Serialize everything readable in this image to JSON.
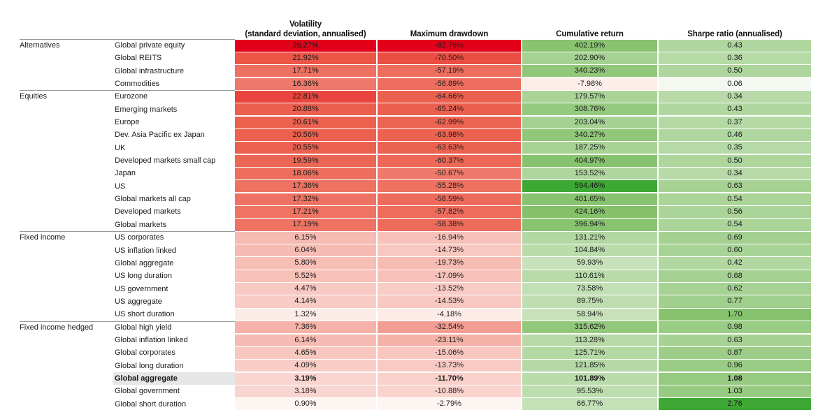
{
  "table": {
    "columns": [
      {
        "id": "volatility",
        "line1": "Volatility",
        "line2": "(standard deviation, annualised)"
      },
      {
        "id": "max_drawdown",
        "line1": "Maximum drawdown",
        "line2": ""
      },
      {
        "id": "cumulative_return",
        "line1": "Cumulative return",
        "line2": ""
      },
      {
        "id": "sharpe_ratio",
        "line1": "Sharpe ratio (annualised)",
        "line2": ""
      }
    ],
    "groups": [
      {
        "name": "Alternatives",
        "rows": [
          {
            "asset": "Global private equity",
            "volatility": "26.27%",
            "max_drawdown": "-82.76%",
            "cumulative_return": "402.19%",
            "sharpe_ratio": "0.43",
            "highlight": false
          },
          {
            "asset": "Global REITS",
            "volatility": "21.92%",
            "max_drawdown": "-70.50%",
            "cumulative_return": "202.90%",
            "sharpe_ratio": "0.36",
            "highlight": false
          },
          {
            "asset": "Global infrastructure",
            "volatility": "17.71%",
            "max_drawdown": "-57.19%",
            "cumulative_return": "340.23%",
            "sharpe_ratio": "0.50",
            "highlight": false
          },
          {
            "asset": "Commodities",
            "volatility": "16.36%",
            "max_drawdown": "-56.89%",
            "cumulative_return": "-7.98%",
            "sharpe_ratio": "0.06",
            "highlight": false
          }
        ]
      },
      {
        "name": "Equities",
        "rows": [
          {
            "asset": "Eurozone",
            "volatility": "22.81%",
            "max_drawdown": "-64.66%",
            "cumulative_return": "179.57%",
            "sharpe_ratio": "0.34",
            "highlight": false
          },
          {
            "asset": "Emerging markets",
            "volatility": "20.88%",
            "max_drawdown": "-65.24%",
            "cumulative_return": "308.76%",
            "sharpe_ratio": "0.43",
            "highlight": false
          },
          {
            "asset": "Europe",
            "volatility": "20.61%",
            "max_drawdown": "-62.99%",
            "cumulative_return": "203.04%",
            "sharpe_ratio": "0.37",
            "highlight": false
          },
          {
            "asset": "Dev. Asia Pacific ex Japan",
            "volatility": "20.56%",
            "max_drawdown": "-63.98%",
            "cumulative_return": "340.27%",
            "sharpe_ratio": "0.46",
            "highlight": false
          },
          {
            "asset": "UK",
            "volatility": "20.55%",
            "max_drawdown": "-63.63%",
            "cumulative_return": "187.25%",
            "sharpe_ratio": "0.35",
            "highlight": false
          },
          {
            "asset": "Developed markets small cap",
            "volatility": "19.59%",
            "max_drawdown": "-60.37%",
            "cumulative_return": "404.97%",
            "sharpe_ratio": "0.50",
            "highlight": false
          },
          {
            "asset": "Japan",
            "volatility": "18.06%",
            "max_drawdown": "-50.67%",
            "cumulative_return": "153.52%",
            "sharpe_ratio": "0.34",
            "highlight": false
          },
          {
            "asset": "US",
            "volatility": "17.36%",
            "max_drawdown": "-55.28%",
            "cumulative_return": "594.46%",
            "sharpe_ratio": "0.63",
            "highlight": false
          },
          {
            "asset": "Global markets all cap",
            "volatility": "17.32%",
            "max_drawdown": "-58.59%",
            "cumulative_return": "401.65%",
            "sharpe_ratio": "0.54",
            "highlight": false
          },
          {
            "asset": "Developed markets",
            "volatility": "17.21%",
            "max_drawdown": "-57.82%",
            "cumulative_return": "424.16%",
            "sharpe_ratio": "0.56",
            "highlight": false
          },
          {
            "asset": "Global markets",
            "volatility": "17.19%",
            "max_drawdown": "-58.38%",
            "cumulative_return": "396.94%",
            "sharpe_ratio": "0.54",
            "highlight": false
          }
        ]
      },
      {
        "name": "Fixed income",
        "rows": [
          {
            "asset": "US corporates",
            "volatility": "6.15%",
            "max_drawdown": "-16.94%",
            "cumulative_return": "131.21%",
            "sharpe_ratio": "0.69",
            "highlight": false
          },
          {
            "asset": "US inflation linked",
            "volatility": "6.04%",
            "max_drawdown": "-14.73%",
            "cumulative_return": "104.84%",
            "sharpe_ratio": "0.60",
            "highlight": false
          },
          {
            "asset": "Global aggregate",
            "volatility": "5.80%",
            "max_drawdown": "-19.73%",
            "cumulative_return": "59.93%",
            "sharpe_ratio": "0.42",
            "highlight": false
          },
          {
            "asset": "US long duration",
            "volatility": "5.52%",
            "max_drawdown": "-17.09%",
            "cumulative_return": "110.61%",
            "sharpe_ratio": "0.68",
            "highlight": false
          },
          {
            "asset": "US government",
            "volatility": "4.47%",
            "max_drawdown": "-13.52%",
            "cumulative_return": "73.58%",
            "sharpe_ratio": "0.62",
            "highlight": false
          },
          {
            "asset": "US aggregate",
            "volatility": "4.14%",
            "max_drawdown": "-14.53%",
            "cumulative_return": "89.75%",
            "sharpe_ratio": "0.77",
            "highlight": false
          },
          {
            "asset": "US short duration",
            "volatility": "1.32%",
            "max_drawdown": "-4.18%",
            "cumulative_return": "58.94%",
            "sharpe_ratio": "1.70",
            "highlight": false
          }
        ]
      },
      {
        "name": "Fixed income hedged",
        "rows": [
          {
            "asset": "Global high yield",
            "volatility": "7.36%",
            "max_drawdown": "-32.54%",
            "cumulative_return": "315.62%",
            "sharpe_ratio": "0.98",
            "highlight": false
          },
          {
            "asset": "Global inflation linked",
            "volatility": "6.14%",
            "max_drawdown": "-23.11%",
            "cumulative_return": "113.28%",
            "sharpe_ratio": "0.63",
            "highlight": false
          },
          {
            "asset": "Global corporates",
            "volatility": "4.65%",
            "max_drawdown": "-15.06%",
            "cumulative_return": "125.71%",
            "sharpe_ratio": "0.87",
            "highlight": false
          },
          {
            "asset": "Global long duration",
            "volatility": "4.09%",
            "max_drawdown": "-13.73%",
            "cumulative_return": "121.85%",
            "sharpe_ratio": "0.96",
            "highlight": false
          },
          {
            "asset": "Global aggregate",
            "volatility": "3.19%",
            "max_drawdown": "-11.70%",
            "cumulative_return": "101.89%",
            "sharpe_ratio": "1.08",
            "highlight": true
          },
          {
            "asset": "Global government",
            "volatility": "3.18%",
            "max_drawdown": "-10.88%",
            "cumulative_return": "95.53%",
            "sharpe_ratio": "1.03",
            "highlight": false
          },
          {
            "asset": "Global short duration",
            "volatility": "0.90%",
            "max_drawdown": "-2.79%",
            "cumulative_return": "66.77%",
            "sharpe_ratio": "2.76",
            "highlight": false
          }
        ]
      }
    ]
  },
  "heatmap": {
    "red_strong": "#E2001A",
    "red_mid": "#E8503F",
    "red_light": "#FBE9E3",
    "red_faint": "#FDF6F3",
    "green_strong": "#3FAA35",
    "green_mid": "#7EBE63",
    "green_light": "#E5EFE0",
    "green_faint": "#F2F7EF",
    "highlight_bg": "#E6E6E6",
    "separator": "#9A9A9A"
  },
  "chart_data": {
    "type": "heatmap",
    "title": "",
    "xlabel": "",
    "ylabel": "",
    "grid": false,
    "legend": "none",
    "columns": [
      "Volatility (standard deviation, annualised)",
      "Maximum drawdown",
      "Cumulative return",
      "Sharpe ratio (annualised)"
    ],
    "row_groups": [
      "Alternatives",
      "Equities",
      "Fixed income",
      "Fixed income hedged"
    ],
    "rows": [
      {
        "group": "Alternatives",
        "asset": "Global private equity",
        "volatility": 26.27,
        "max_drawdown": -82.76,
        "cumulative_return": 402.19,
        "sharpe_ratio": 0.43
      },
      {
        "group": "Alternatives",
        "asset": "Global REITS",
        "volatility": 21.92,
        "max_drawdown": -70.5,
        "cumulative_return": 202.9,
        "sharpe_ratio": 0.36
      },
      {
        "group": "Alternatives",
        "asset": "Global infrastructure",
        "volatility": 17.71,
        "max_drawdown": -57.19,
        "cumulative_return": 340.23,
        "sharpe_ratio": 0.5
      },
      {
        "group": "Alternatives",
        "asset": "Commodities",
        "volatility": 16.36,
        "max_drawdown": -56.89,
        "cumulative_return": -7.98,
        "sharpe_ratio": 0.06
      },
      {
        "group": "Equities",
        "asset": "Eurozone",
        "volatility": 22.81,
        "max_drawdown": -64.66,
        "cumulative_return": 179.57,
        "sharpe_ratio": 0.34
      },
      {
        "group": "Equities",
        "asset": "Emerging markets",
        "volatility": 20.88,
        "max_drawdown": -65.24,
        "cumulative_return": 308.76,
        "sharpe_ratio": 0.43
      },
      {
        "group": "Equities",
        "asset": "Europe",
        "volatility": 20.61,
        "max_drawdown": -62.99,
        "cumulative_return": 203.04,
        "sharpe_ratio": 0.37
      },
      {
        "group": "Equities",
        "asset": "Dev. Asia Pacific ex Japan",
        "volatility": 20.56,
        "max_drawdown": -63.98,
        "cumulative_return": 340.27,
        "sharpe_ratio": 0.46
      },
      {
        "group": "Equities",
        "asset": "UK",
        "volatility": 20.55,
        "max_drawdown": -63.63,
        "cumulative_return": 187.25,
        "sharpe_ratio": 0.35
      },
      {
        "group": "Equities",
        "asset": "Developed markets small cap",
        "volatility": 19.59,
        "max_drawdown": -60.37,
        "cumulative_return": 404.97,
        "sharpe_ratio": 0.5
      },
      {
        "group": "Equities",
        "asset": "Japan",
        "volatility": 18.06,
        "max_drawdown": -50.67,
        "cumulative_return": 153.52,
        "sharpe_ratio": 0.34
      },
      {
        "group": "Equities",
        "asset": "US",
        "volatility": 17.36,
        "max_drawdown": -55.28,
        "cumulative_return": 594.46,
        "sharpe_ratio": 0.63
      },
      {
        "group": "Equities",
        "asset": "Global markets all cap",
        "volatility": 17.32,
        "max_drawdown": -58.59,
        "cumulative_return": 401.65,
        "sharpe_ratio": 0.54
      },
      {
        "group": "Equities",
        "asset": "Developed markets",
        "volatility": 17.21,
        "max_drawdown": -57.82,
        "cumulative_return": 424.16,
        "sharpe_ratio": 0.56
      },
      {
        "group": "Equities",
        "asset": "Global markets",
        "volatility": 17.19,
        "max_drawdown": -58.38,
        "cumulative_return": 396.94,
        "sharpe_ratio": 0.54
      },
      {
        "group": "Fixed income",
        "asset": "US corporates",
        "volatility": 6.15,
        "max_drawdown": -16.94,
        "cumulative_return": 131.21,
        "sharpe_ratio": 0.69
      },
      {
        "group": "Fixed income",
        "asset": "US inflation linked",
        "volatility": 6.04,
        "max_drawdown": -14.73,
        "cumulative_return": 104.84,
        "sharpe_ratio": 0.6
      },
      {
        "group": "Fixed income",
        "asset": "Global aggregate",
        "volatility": 5.8,
        "max_drawdown": -19.73,
        "cumulative_return": 59.93,
        "sharpe_ratio": 0.42
      },
      {
        "group": "Fixed income",
        "asset": "US long duration",
        "volatility": 5.52,
        "max_drawdown": -17.09,
        "cumulative_return": 110.61,
        "sharpe_ratio": 0.68
      },
      {
        "group": "Fixed income",
        "asset": "US government",
        "volatility": 4.47,
        "max_drawdown": -13.52,
        "cumulative_return": 73.58,
        "sharpe_ratio": 0.62
      },
      {
        "group": "Fixed income",
        "asset": "US aggregate",
        "volatility": 4.14,
        "max_drawdown": -14.53,
        "cumulative_return": 89.75,
        "sharpe_ratio": 0.77
      },
      {
        "group": "Fixed income",
        "asset": "US short duration",
        "volatility": 1.32,
        "max_drawdown": -4.18,
        "cumulative_return": 58.94,
        "sharpe_ratio": 1.7
      },
      {
        "group": "Fixed income hedged",
        "asset": "Global high yield",
        "volatility": 7.36,
        "max_drawdown": -32.54,
        "cumulative_return": 315.62,
        "sharpe_ratio": 0.98
      },
      {
        "group": "Fixed income hedged",
        "asset": "Global inflation linked",
        "volatility": 6.14,
        "max_drawdown": -23.11,
        "cumulative_return": 113.28,
        "sharpe_ratio": 0.63
      },
      {
        "group": "Fixed income hedged",
        "asset": "Global corporates",
        "volatility": 4.65,
        "max_drawdown": -15.06,
        "cumulative_return": 125.71,
        "sharpe_ratio": 0.87
      },
      {
        "group": "Fixed income hedged",
        "asset": "Global long duration",
        "volatility": 4.09,
        "max_drawdown": -13.73,
        "cumulative_return": 121.85,
        "sharpe_ratio": 0.96
      },
      {
        "group": "Fixed income hedged",
        "asset": "Global aggregate",
        "volatility": 3.19,
        "max_drawdown": -11.7,
        "cumulative_return": 101.89,
        "sharpe_ratio": 1.08
      },
      {
        "group": "Fixed income hedged",
        "asset": "Global government",
        "volatility": 3.18,
        "max_drawdown": -10.88,
        "cumulative_return": 95.53,
        "sharpe_ratio": 1.03
      },
      {
        "group": "Fixed income hedged",
        "asset": "Global short duration",
        "volatility": 0.9,
        "max_drawdown": -2.79,
        "cumulative_return": 66.77,
        "sharpe_ratio": 2.76
      }
    ]
  }
}
